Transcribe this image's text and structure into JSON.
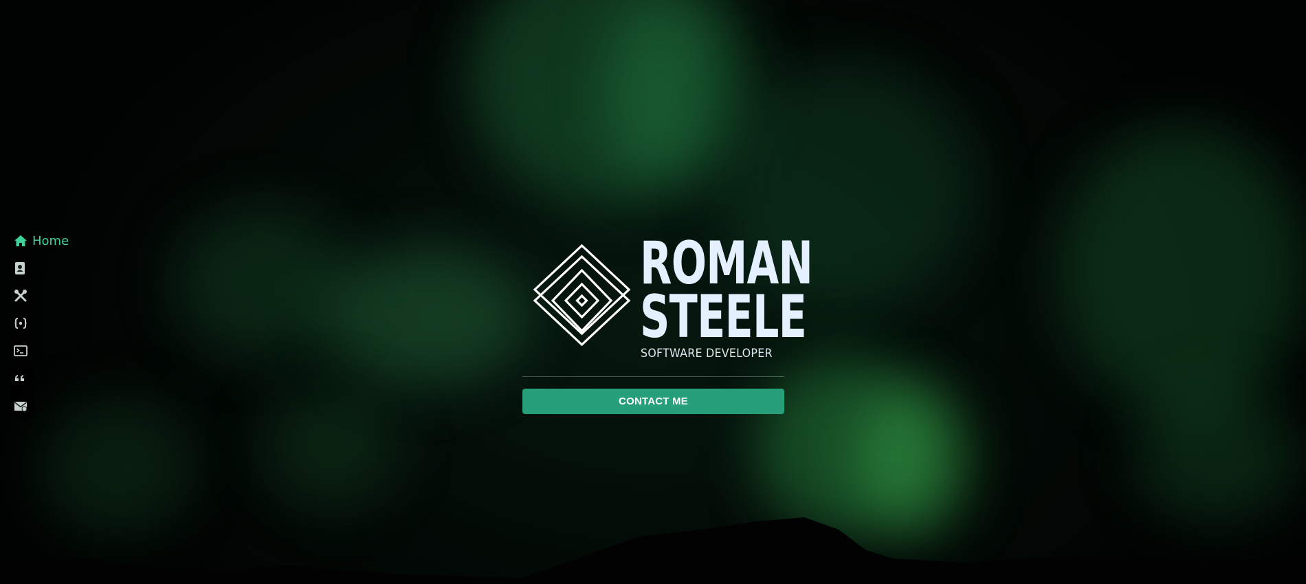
{
  "colors": {
    "accent": "#27a07a",
    "nav_active": "#3fd19a",
    "nav_icon": "#c8d2cd",
    "title_text": "#e4f0ff"
  },
  "nav": {
    "items": [
      {
        "icon": "home-icon",
        "label": "Home",
        "active": true
      },
      {
        "icon": "contact-card-icon",
        "label": "",
        "active": false
      },
      {
        "icon": "tools-icon",
        "label": "",
        "active": false
      },
      {
        "icon": "code-braces-icon",
        "label": "",
        "active": false
      },
      {
        "icon": "terminal-icon",
        "label": "",
        "active": false
      },
      {
        "icon": "quote-icon",
        "label": "",
        "active": false
      },
      {
        "icon": "mail-icon",
        "label": "",
        "active": false
      }
    ]
  },
  "hero": {
    "name_line1": "ROMAN",
    "name_line2": "STEELE",
    "subtitle": "SOFTWARE DEVELOPER",
    "contact_label": "CONTACT ME",
    "logo_icon": "nested-diamond-logo-icon"
  }
}
